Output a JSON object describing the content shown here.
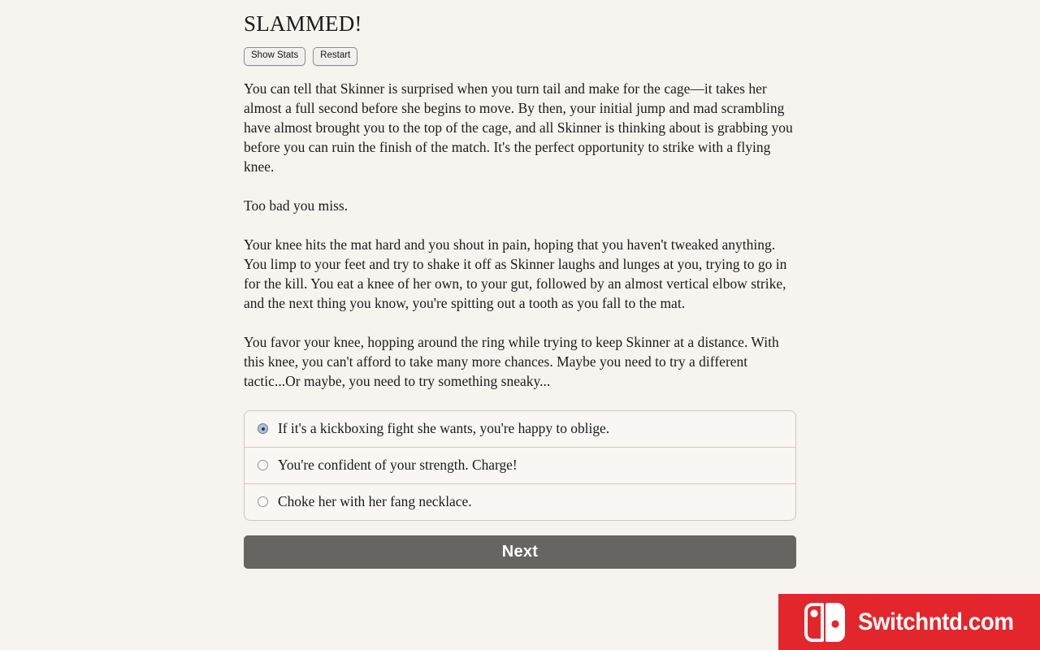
{
  "page": {
    "title": "SLAMMED!",
    "background_color": "#f7f3ef",
    "text_color": "#1b1b1b"
  },
  "toolbar": {
    "show_stats_label": "Show Stats",
    "restart_label": "Restart"
  },
  "story": {
    "paragraphs": [
      "You can tell that Skinner is surprised when you turn tail and make for the cage—it takes her almost a full second before she begins to move. By then, your initial jump and mad scrambling have almost brought you to the top of the cage, and all Skinner is thinking about is grabbing you before you can ruin the finish of the match. It's the perfect opportunity to strike with a flying knee.",
      "Too bad you miss.",
      "Your knee hits the mat hard and you shout in pain, hoping that you haven't tweaked anything. You limp to your feet and try to shake it off as Skinner laughs and lunges at you, trying to go in for the kill. You eat a knee of her own, to your gut, followed by an almost vertical elbow strike, and the next thing you know, you're spitting out a tooth as you fall to the mat.",
      "You favor your knee, hopping around the ring while trying to keep Skinner at a distance. With this knee, you can't afford to take many more chances. Maybe you need to try a different tactic...Or maybe, you need to try something sneaky..."
    ]
  },
  "choices": {
    "selected_index": 0,
    "options": [
      {
        "label": "If it's a kickboxing fight she wants, you're happy to oblige.",
        "selected": true
      },
      {
        "label": "You're confident of your strength. Charge!",
        "selected": false
      },
      {
        "label": "Choke her with her fang necklace.",
        "selected": false
      }
    ]
  },
  "next_button": {
    "label": "Next",
    "background_color": "#676461",
    "text_color": "#ffffff"
  },
  "watermark": {
    "text": "Switchntd.com",
    "logo_icon": "nintendo-switch-icon",
    "background_color": "#e3262b",
    "text_color": "#ffffff"
  }
}
